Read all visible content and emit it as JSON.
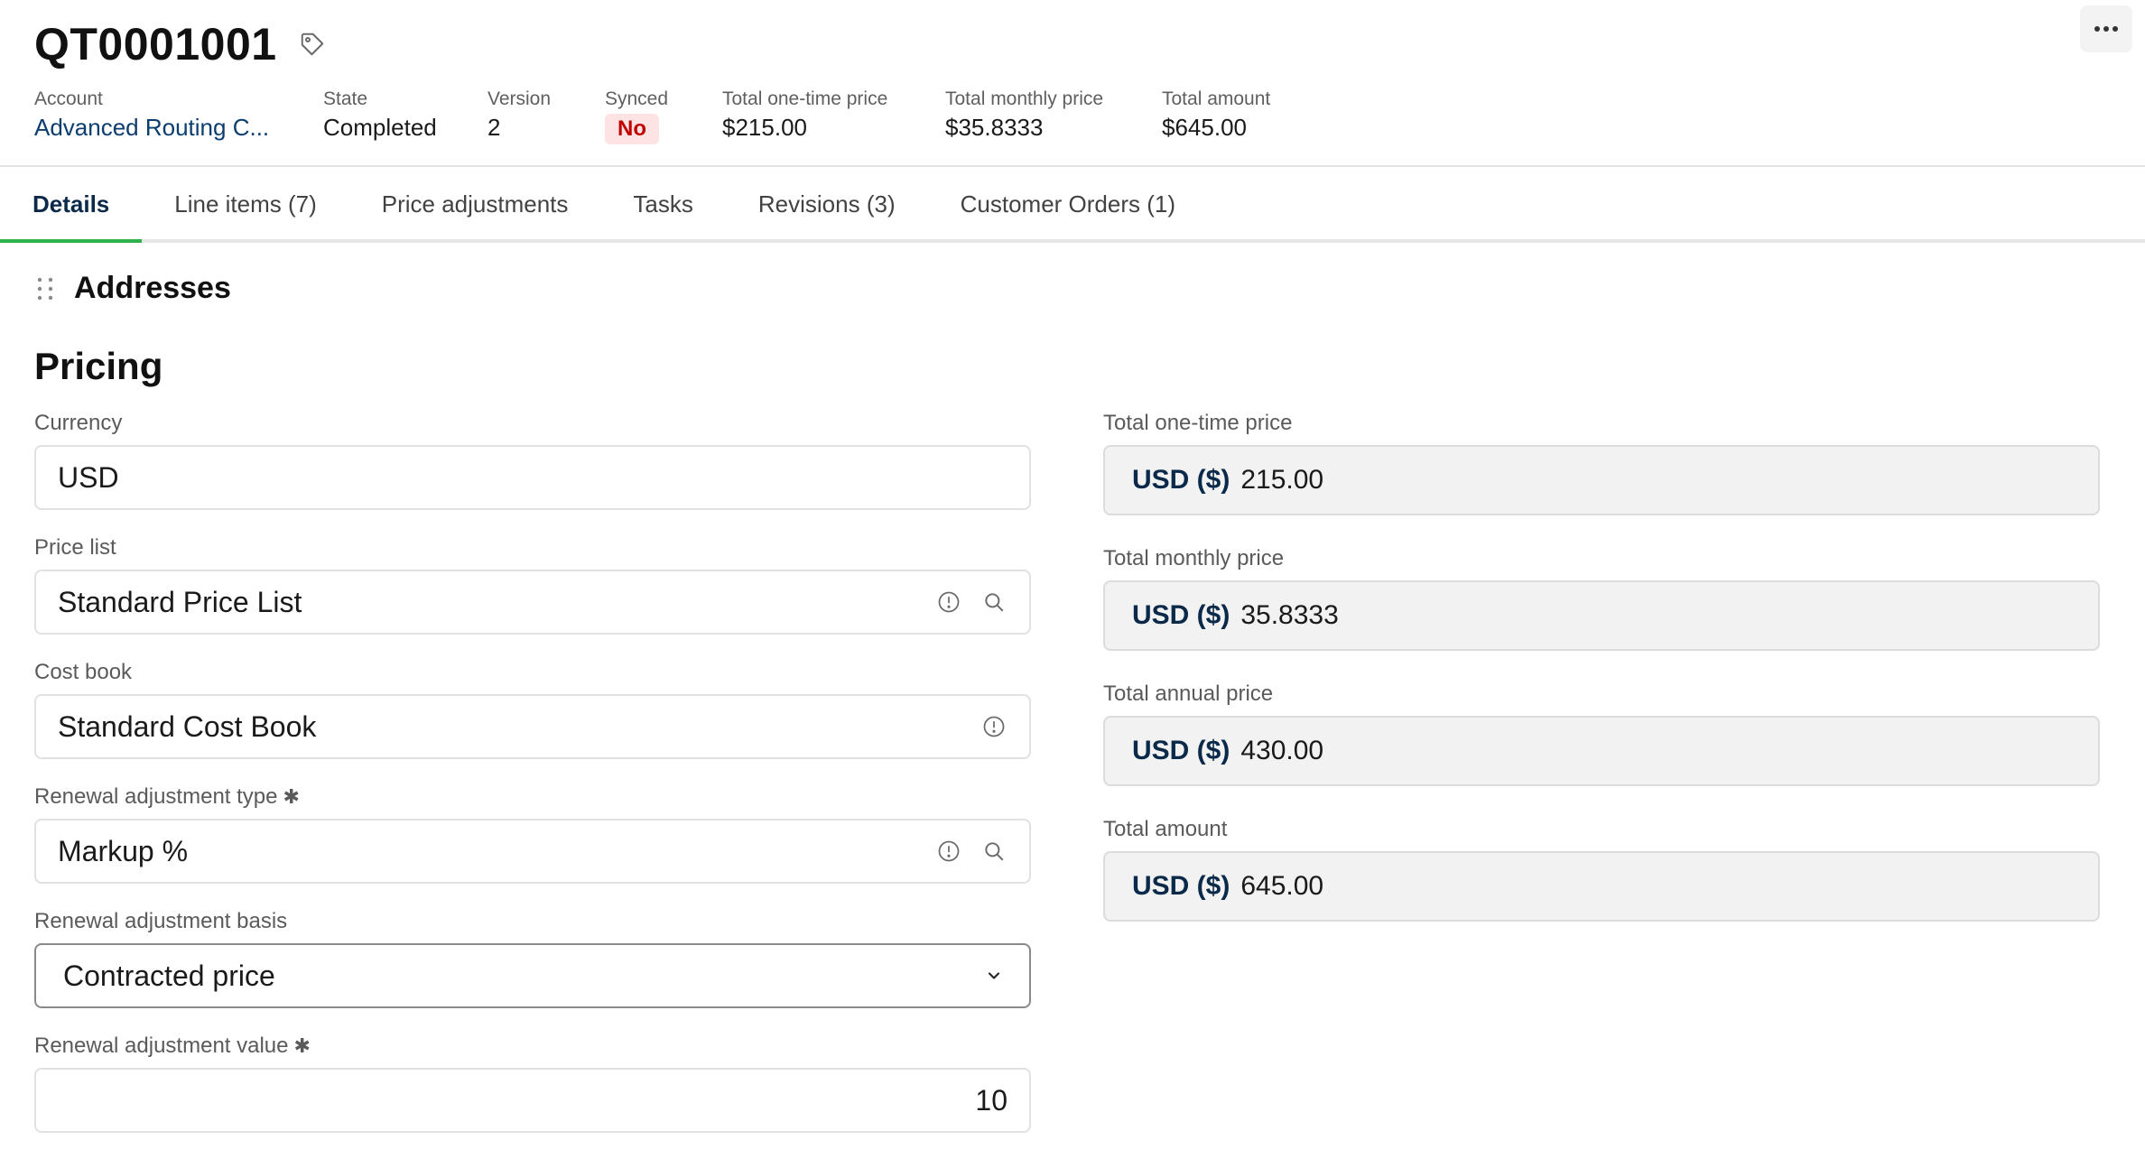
{
  "header": {
    "title": "QT0001001",
    "meta": [
      {
        "label": "Account",
        "value": "Advanced Routing C..."
      },
      {
        "label": "State",
        "value": "Completed"
      },
      {
        "label": "Version",
        "value": "2"
      },
      {
        "label": "Synced",
        "value": "No"
      },
      {
        "label": "Total one-time price",
        "value": "$215.00"
      },
      {
        "label": "Total monthly price",
        "value": "$35.8333"
      },
      {
        "label": "Total amount",
        "value": "$645.00"
      }
    ]
  },
  "tabs": [
    {
      "label": "Details",
      "active": true
    },
    {
      "label": "Line items (7)"
    },
    {
      "label": "Price adjustments"
    },
    {
      "label": "Tasks"
    },
    {
      "label": "Revisions (3)"
    },
    {
      "label": "Customer Orders (1)"
    }
  ],
  "addresses": {
    "title": "Addresses"
  },
  "pricing": {
    "title": "Pricing",
    "left": {
      "currency": {
        "label": "Currency",
        "value": "USD"
      },
      "price_list": {
        "label": "Price list",
        "value": "Standard Price List"
      },
      "cost_book": {
        "label": "Cost book",
        "value": "Standard Cost Book"
      },
      "renewal_type": {
        "label": "Renewal adjustment type",
        "required_mark": "✱",
        "value": "Markup %"
      },
      "renewal_basis": {
        "label": "Renewal adjustment basis",
        "value": "Contracted price"
      },
      "renewal_value": {
        "label": "Renewal adjustment value",
        "required_mark": "✱",
        "value": "10"
      }
    },
    "right": {
      "currency_prefix": "USD ($)",
      "one_time": {
        "label": "Total one-time price",
        "value": "215.00"
      },
      "monthly": {
        "label": "Total monthly price",
        "value": "35.8333"
      },
      "annual": {
        "label": "Total annual price",
        "value": "430.00"
      },
      "amount": {
        "label": "Total amount",
        "value": "645.00"
      }
    }
  },
  "colors": {
    "accent": "#2eb34a",
    "link": "#0b3d6e",
    "badge_bg": "#fde3e3",
    "badge_text": "#c00000"
  },
  "icons": [
    "tag-icon",
    "more-icon",
    "drag-handle-icon",
    "info-icon",
    "search-icon",
    "chevron-down-icon"
  ]
}
